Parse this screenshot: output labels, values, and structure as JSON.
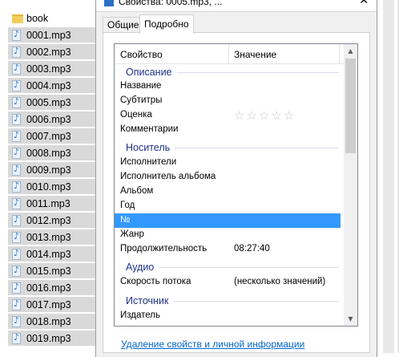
{
  "explorer": {
    "folder": "book",
    "files": [
      "0001.mp3",
      "0002.mp3",
      "0003.mp3",
      "0004.mp3",
      "0005.mp3",
      "0006.mp3",
      "0007.mp3",
      "0008.mp3",
      "0009.mp3",
      "0010.mp3",
      "0011.mp3",
      "0012.mp3",
      "0013.mp3",
      "0014.mp3",
      "0015.mp3",
      "0016.mp3",
      "0017.mp3",
      "0018.mp3",
      "0019.mp3"
    ]
  },
  "dialog": {
    "title": "Свойства: 0005.mp3, ...",
    "tabs": [
      "Общие",
      "Подробно"
    ],
    "active_tab": "Подробно",
    "columns": {
      "property": "Свойство",
      "value": "Значение"
    },
    "groups": {
      "description": "Описание",
      "media": "Носитель",
      "audio": "Аудио",
      "origin": "Источник"
    },
    "props": {
      "name": "Название",
      "subtitles": "Субтитры",
      "rating": "Оценка",
      "rating_stars": "☆☆☆☆☆",
      "rating_value": 0,
      "comments": "Комментарии",
      "artists": "Исполнители",
      "album_artist": "Исполнитель альбома",
      "album": "Альбом",
      "year": "Год",
      "track": "№",
      "genre": "Жанр",
      "duration": "Продолжительность",
      "duration_value": "08:27:40",
      "bitrate": "Скорость потока",
      "bitrate_value": "(несколько значений)",
      "publisher": "Издатель"
    },
    "remove_link": "Удаление свойств и личной информации"
  }
}
